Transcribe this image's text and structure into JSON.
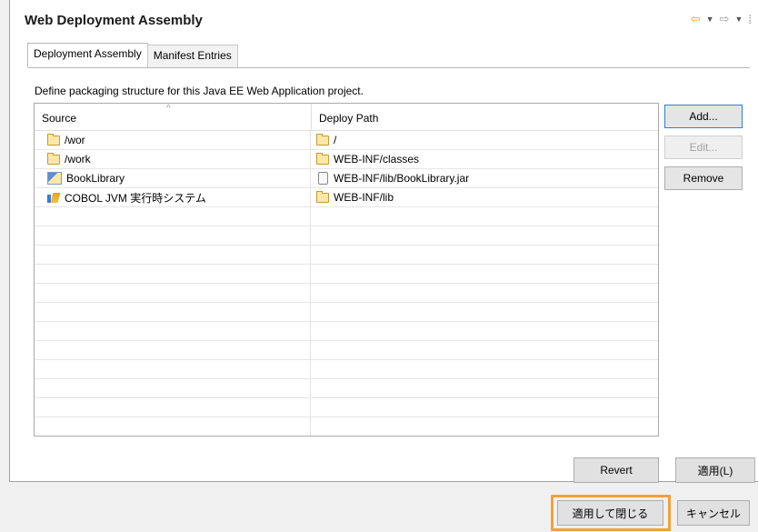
{
  "header": {
    "title": "Web Deployment Assembly"
  },
  "tabs": [
    {
      "label": "Deployment Assembly"
    },
    {
      "label": "Manifest Entries"
    }
  ],
  "description": "Define packaging structure for this Java EE Web Application project.",
  "table": {
    "columns": [
      "Source",
      "Deploy Path"
    ],
    "rows": [
      {
        "source": "/wor",
        "source_icon": "folder-icon",
        "deploy": "/",
        "deploy_icon": "folder-icon"
      },
      {
        "source": "/work",
        "source_icon": "folder-icon",
        "deploy": "WEB-INF/classes",
        "deploy_icon": "folder-icon"
      },
      {
        "source": "BookLibrary",
        "source_icon": "java-project-icon",
        "deploy": "WEB-INF/lib/BookLibrary.jar",
        "deploy_icon": "jar-icon"
      },
      {
        "source": "COBOL JVM 実行時システム",
        "source_icon": "library-icon",
        "deploy": "WEB-INF/lib",
        "deploy_icon": "folder-icon"
      }
    ]
  },
  "side_buttons": {
    "add": "Add...",
    "edit": "Edit...",
    "remove": "Remove"
  },
  "bottom_buttons": {
    "revert": "Revert",
    "apply": "適用(L)",
    "apply_close": "適用して閉じる",
    "cancel": "キャンセル"
  },
  "colors": {
    "highlight": "#f4a038",
    "back_arrow": "#e3a300"
  }
}
